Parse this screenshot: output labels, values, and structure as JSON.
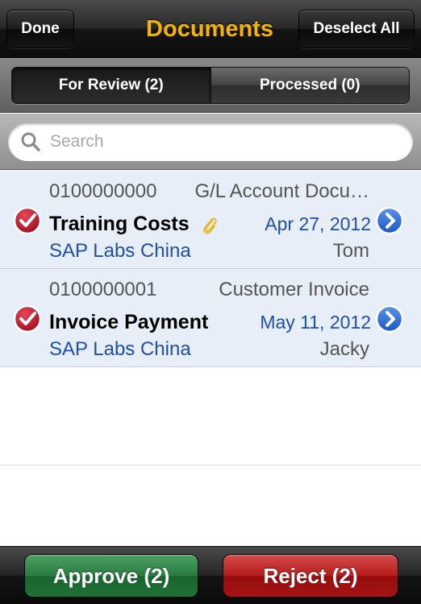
{
  "navbar": {
    "done_label": "Done",
    "title": "Documents",
    "deselect_label": "Deselect All"
  },
  "segments": {
    "for_review": "For Review (2)",
    "processed": "Processed (0)",
    "selected": "For Review (2)"
  },
  "search": {
    "placeholder": "Search",
    "value": ""
  },
  "documents": [
    {
      "id": "0100000000",
      "type": "G/L Account Docu…",
      "title": "Training Costs",
      "has_attachment": true,
      "date": "Apr 27, 2012",
      "company": "SAP Labs China",
      "person": "Tom",
      "checked": true
    },
    {
      "id": "0100000001",
      "type": "Customer Invoice",
      "title": "Invoice Payment",
      "has_attachment": false,
      "date": "May 11, 2012",
      "company": "SAP Labs China",
      "person": "Jacky",
      "checked": true
    }
  ],
  "toolbar": {
    "approve_label": "Approve (2)",
    "reject_label": "Reject (2)"
  },
  "colors": {
    "title_accent": "#f5b400",
    "link_blue": "#1f4fa8",
    "approve_green": "#2a7b41",
    "reject_red": "#b31c1c",
    "check_red": "#c41a2b",
    "row_selected_bg": "#e8eef8"
  },
  "icons": {
    "search": "search-icon",
    "check": "checkmark-icon",
    "disclosure": "chevron-right-icon",
    "attachment": "paperclip-icon"
  }
}
